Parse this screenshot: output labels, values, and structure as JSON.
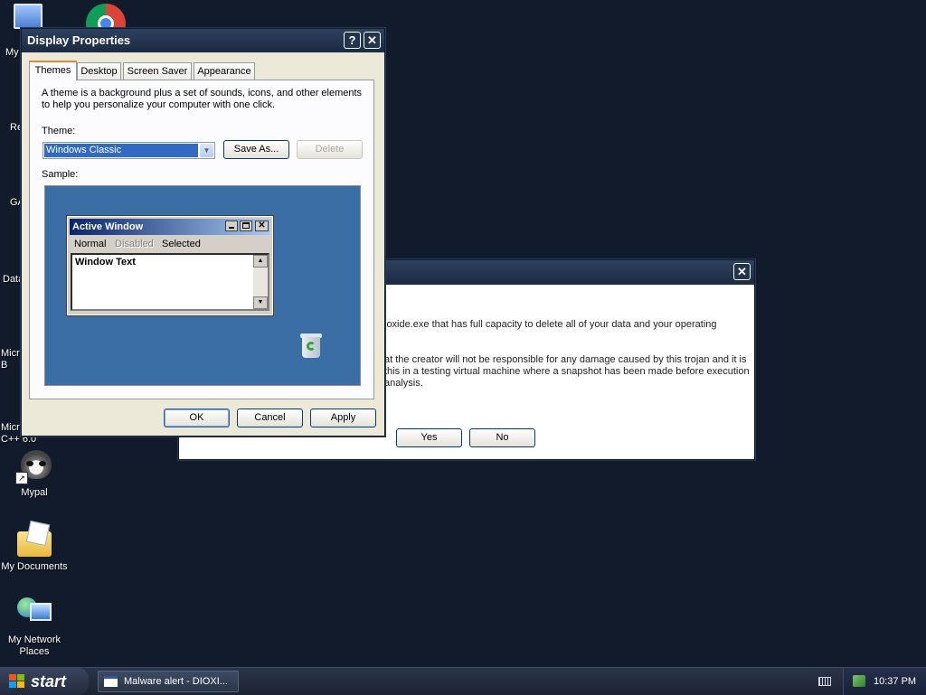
{
  "desktop_icons": [
    {
      "label": "My"
    },
    {
      "label": "Re"
    },
    {
      "label": "GA"
    },
    {
      "label": "Data"
    },
    {
      "label": "Micro B"
    },
    {
      "label": "Micro C++ 6.0"
    },
    {
      "label": "Mypal"
    },
    {
      "label": "My Documents"
    },
    {
      "label": "My Network Places"
    }
  ],
  "alert_dialog": {
    "close_symbol": "✕",
    "line1": "ioxide.exe that has full capacity to delete all of your data and your operating",
    "line2": "at the creator will not be responsible for any damage caused by this trojan and it is",
    "line3": "this in a testing virtual machine where a snapshot has been made before execution",
    "line4": "analysis.",
    "yes_label": "Yes",
    "no_label": "No"
  },
  "display_properties": {
    "title": "Display Properties",
    "help_symbol": "?",
    "close_symbol": "✕",
    "tabs": [
      {
        "label": "Themes"
      },
      {
        "label": "Desktop"
      },
      {
        "label": "Screen Saver"
      },
      {
        "label": "Appearance"
      }
    ],
    "description_line1": "A theme is a background plus a set of sounds, icons, and other elements",
    "description_line2": "to help you personalize your computer with one click.",
    "theme_label": "Theme:",
    "theme_value": "Windows Classic",
    "save_as_label": "Save As...",
    "delete_label": "Delete",
    "sample_label": "Sample:",
    "sample": {
      "active_window_title": "Active Window",
      "menu_normal": "Normal",
      "menu_disabled": "Disabled",
      "menu_selected": "Selected",
      "window_text": "Window Text",
      "background_color": "#3a6ea5"
    },
    "ok_label": "OK",
    "cancel_label": "Cancel",
    "apply_label": "Apply"
  },
  "taskbar": {
    "start_label": "start",
    "task_label": "Malware alert - DIOXI...",
    "clock": "10:37 PM"
  },
  "colors": {
    "desktop": "#111b2b",
    "title_bar": "#1c2a42",
    "dialog_face": "#ece9d8",
    "sample_blue": "#3a6ea5",
    "classic_title": "#0a246a"
  }
}
